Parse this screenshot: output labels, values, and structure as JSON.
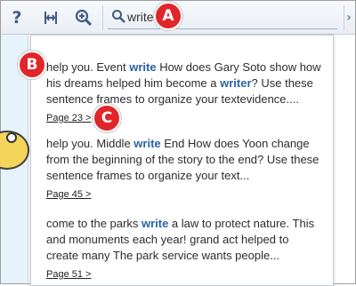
{
  "toolbar": {
    "help_icon": "question-mark-icon",
    "help_label": "?",
    "fit_icon": "fit-width-icon",
    "zoom_icon": "zoom-in-icon",
    "search_icon": "search-icon",
    "search_value": "write"
  },
  "results": [
    {
      "text_before": "help you. Event ",
      "keyword": "write",
      "text_mid": " How does Gary Soto show how his dreams helped him become a ",
      "keyword2": "writer",
      "text_after": "? Use these sentence frames to organize your textevidence....",
      "page_link": "Page 23 >"
    },
    {
      "text_before": "help you. Middle ",
      "keyword": "write",
      "text_after": " End How does Yoon change from the beginning of the story to the end? Use these sentence frames to organize your text...",
      "page_link": "Page 45 >"
    },
    {
      "text_before": "come to the parks ",
      "keyword": "write",
      "text_after": " a law to protect nature. This and monuments each year! grand act helped to create many The park service wants people...",
      "page_link": "Page 51 >"
    }
  ],
  "markers": {
    "a": "A",
    "b": "B",
    "c": "C"
  },
  "colors": {
    "keyword": "#2a63a6",
    "marker": "#e0262b",
    "toolbar_icon": "#3f5b7f"
  }
}
